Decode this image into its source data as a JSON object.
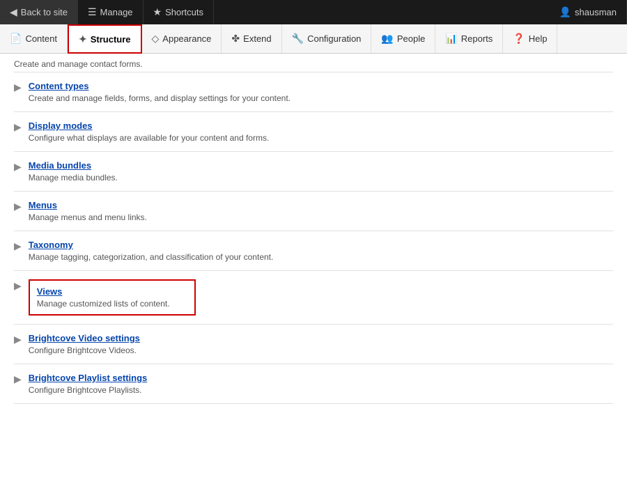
{
  "adminBar": {
    "backToSite": "Back to site",
    "manage": "Manage",
    "shortcuts": "Shortcuts",
    "username": "shausman"
  },
  "navTabs": [
    {
      "id": "content",
      "label": "Content",
      "icon": "📄"
    },
    {
      "id": "structure",
      "label": "Structure",
      "icon": "🔧",
      "active": true
    },
    {
      "id": "appearance",
      "label": "Appearance",
      "icon": "🎨"
    },
    {
      "id": "extend",
      "label": "Extend",
      "icon": "🧩"
    },
    {
      "id": "configuration",
      "label": "Configuration",
      "icon": "🔩"
    },
    {
      "id": "people",
      "label": "People",
      "icon": "👤"
    },
    {
      "id": "reports",
      "label": "Reports",
      "icon": "📊"
    },
    {
      "id": "help",
      "label": "Help",
      "icon": "❓"
    }
  ],
  "listItems": [
    {
      "id": "contact-forms",
      "title": null,
      "desc": "Create and manage contact forms.",
      "partial": true
    },
    {
      "id": "content-types",
      "title": "Content types",
      "desc": "Create and manage fields, forms, and display settings for your content."
    },
    {
      "id": "display-modes",
      "title": "Display modes",
      "desc": "Configure what displays are available for your content and forms."
    },
    {
      "id": "media-bundles",
      "title": "Media bundles",
      "desc": "Manage media bundles."
    },
    {
      "id": "menus",
      "title": "Menus",
      "desc": "Manage menus and menu links."
    },
    {
      "id": "taxonomy",
      "title": "Taxonomy",
      "desc": "Manage tagging, categorization, and classification of your content."
    },
    {
      "id": "views",
      "title": "Views",
      "desc": "Manage customized lists of content.",
      "highlighted": true
    },
    {
      "id": "brightcove-video",
      "title": "Brightcove Video settings",
      "desc": "Configure Brightcove Videos."
    },
    {
      "id": "brightcove-playlist",
      "title": "Brightcove Playlist settings",
      "desc": "Configure Brightcove Playlists."
    }
  ]
}
